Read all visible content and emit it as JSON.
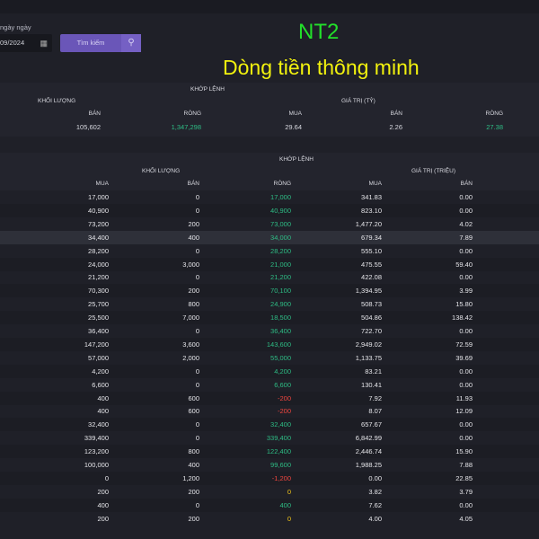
{
  "filter": {
    "label": "ngày ngày",
    "date_value": "09/2024",
    "search_label": "Tìm kiếm"
  },
  "overlay": {
    "ticker": "NT2",
    "slogan": "Dòng tiền thông minh"
  },
  "summary": {
    "group": "KHỚP LỆNH",
    "vol_header": "KHỐI LƯỢNG",
    "val_header": "GIÁ TRỊ (TỶ)",
    "cols": [
      "BÁN",
      "RÒNG",
      "MUA",
      "BÁN",
      "RÒNG"
    ],
    "values": [
      "105,602",
      "1,347,298",
      "29.64",
      "2.26",
      "27.38"
    ]
  },
  "detail": {
    "group": "KHỚP LỆNH",
    "vol_header": "KHỐI LƯỢNG",
    "val_header": "GIÁ TRỊ (TRIỆU)",
    "cols": [
      "MUA",
      "BÁN",
      "RÒNG",
      "MUA",
      "BÁN"
    ],
    "rows": [
      [
        "17,000",
        "0",
        "17,000",
        "341.83",
        "0.00"
      ],
      [
        "40,900",
        "0",
        "40,900",
        "823.10",
        "0.00"
      ],
      [
        "73,200",
        "200",
        "73,000",
        "1,477.20",
        "4.02"
      ],
      [
        "34,400",
        "400",
        "34,000",
        "679.34",
        "7.89"
      ],
      [
        "28,200",
        "0",
        "28,200",
        "555.10",
        "0.00"
      ],
      [
        "24,000",
        "3,000",
        "21,000",
        "475.55",
        "59.40"
      ],
      [
        "21,200",
        "0",
        "21,200",
        "422.08",
        "0.00"
      ],
      [
        "70,300",
        "200",
        "70,100",
        "1,394.95",
        "3.99"
      ],
      [
        "25,700",
        "800",
        "24,900",
        "508.73",
        "15.80"
      ],
      [
        "25,500",
        "7,000",
        "18,500",
        "504.86",
        "138.42"
      ],
      [
        "36,400",
        "0",
        "36,400",
        "722.70",
        "0.00"
      ],
      [
        "147,200",
        "3,600",
        "143,600",
        "2,949.02",
        "72.59"
      ],
      [
        "57,000",
        "2,000",
        "55,000",
        "1,133.75",
        "39.69"
      ],
      [
        "4,200",
        "0",
        "4,200",
        "83.21",
        "0.00"
      ],
      [
        "6,600",
        "0",
        "6,600",
        "130.41",
        "0.00"
      ],
      [
        "400",
        "600",
        "-200",
        "7.92",
        "11.93"
      ],
      [
        "400",
        "600",
        "-200",
        "8.07",
        "12.09"
      ],
      [
        "32,400",
        "0",
        "32,400",
        "657.67",
        "0.00"
      ],
      [
        "339,400",
        "0",
        "339,400",
        "6,842.99",
        "0.00"
      ],
      [
        "123,200",
        "800",
        "122,400",
        "2,446.74",
        "15.90"
      ],
      [
        "100,000",
        "400",
        "99,600",
        "1,988.25",
        "7.88"
      ],
      [
        "0",
        "1,200",
        "-1,200",
        "0.00",
        "22.85"
      ],
      [
        "200",
        "200",
        "0",
        "3.82",
        "3.79"
      ],
      [
        "400",
        "0",
        "400",
        "7.62",
        "0.00"
      ],
      [
        "200",
        "200",
        "0",
        "4.00",
        "4.05"
      ]
    ]
  },
  "colors": {
    "positive": "#2ebd85",
    "negative": "#f0463f",
    "zero": "#f0c419"
  }
}
